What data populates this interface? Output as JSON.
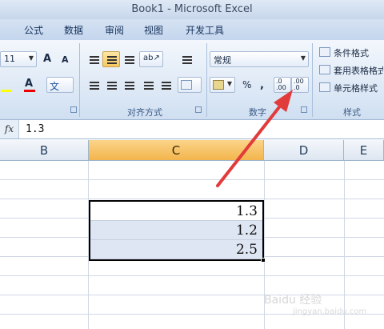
{
  "window": {
    "title": "Book1 - Microsoft Excel"
  },
  "tabs": [
    "公式",
    "数据",
    "审阅",
    "视图",
    "开发工具"
  ],
  "ribbon": {
    "font_size": "11",
    "number_format": "常规",
    "percent_label": "%",
    "comma_label": ",",
    "increase_decimal_label": ".0 .00",
    "decrease_decimal_label": ".00 .0",
    "styles_items": [
      "条件格式",
      "套用表格格式",
      "单元格样式"
    ],
    "group_labels": {
      "alignment": "对齐方式",
      "number": "数字",
      "styles": "样式"
    }
  },
  "formula_bar": {
    "fx_label": "fx",
    "value": "1.3"
  },
  "columns": {
    "b": "B",
    "c": "C",
    "d": "D",
    "e": "E"
  },
  "cells": [
    "1.3",
    "1.2",
    "2.5"
  ],
  "watermark": {
    "text": "Baidu 经验",
    "sub": "jingyan.baidu.com"
  },
  "colors": {
    "arrow": "#e23b3b",
    "active_header": "#f3b54c",
    "selection_fill": "#dfe6f3"
  }
}
